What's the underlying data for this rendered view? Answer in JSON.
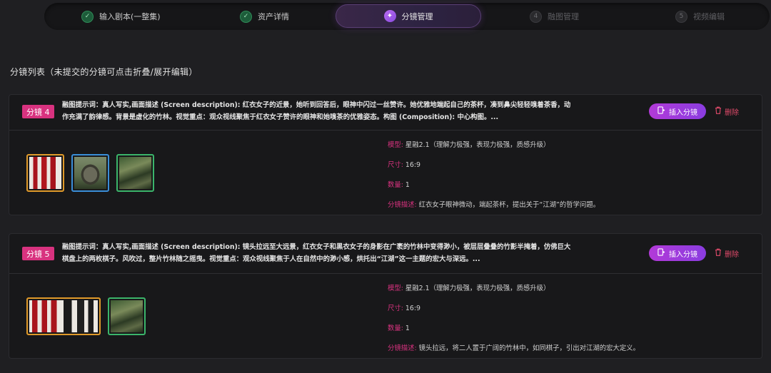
{
  "steps": [
    {
      "num": "✓",
      "label": "输入剧本(一整集)",
      "state": "done"
    },
    {
      "num": "✓",
      "label": "资产详情",
      "state": "done"
    },
    {
      "num": "✦",
      "label": "分镜管理",
      "state": "active"
    },
    {
      "num": "4",
      "label": "融图管理",
      "state": "todo"
    },
    {
      "num": "5",
      "label": "视频编辑",
      "state": "todo"
    }
  ],
  "section_title": "分镜列表（未提交的分镜可点击折叠/展开编辑）",
  "shots": [
    {
      "tag": "分镜 4",
      "prompt": "融图提示词：真人写实,画面描述 (Screen description): 红衣女子的近景，她听到回答后，眼神中闪过一丝赞许。她优雅地端起自己的茶杯，凑到鼻尖轻轻嗅着茶香，动作充满了韵律感。背景是虚化的竹林。视觉重点：观众视线聚焦于红衣女子赞许的眼神和她嗅茶的优雅姿态。构图 (Composition): 中心构图。...",
      "insert_label": "插入分镜",
      "delete_label": "删除",
      "model_key": "模型:",
      "model_val": "星融2.1（理解力极强，表现力极强，质感升级）",
      "size_key": "尺寸:",
      "size_val": "16:9",
      "count_key": "数量:",
      "count_val": "1",
      "desc_key": "分镜描述:",
      "desc_val": "红衣女子眼神微动，端起茶杯，提出关于“江湖”的哲学问题。"
    },
    {
      "tag": "分镜 5",
      "prompt": "融图提示词：真人写实,画面描述 (Screen description): 镜头拉远至大远景，红衣女子和黑衣女子的身影在广袤的竹林中变得渺小，被层层叠叠的竹影半掩着，仿佛巨大棋盘上的两枚棋子。风吹过，整片竹林随之摇曳。视觉重点：观众视线聚焦于人在自然中的渺小感，烘托出“江湖”这一主题的宏大与深远。...",
      "insert_label": "插入分镜",
      "delete_label": "删除",
      "model_key": "模型:",
      "model_val": "星融2.1（理解力极强，表现力极强，质感升级）",
      "size_key": "尺寸:",
      "size_val": "16:9",
      "count_key": "数量:",
      "count_val": "1",
      "desc_key": "分镜描述:",
      "desc_val": "镜头拉远，将二人置于广阔的竹林中，如同棋子，引出对江湖的宏大定义。"
    }
  ],
  "icons": {
    "check": "check-icon",
    "active": "sparkle-icon",
    "insert": "insert-shot-icon",
    "delete": "trash-icon"
  },
  "colors": {
    "accent_pink": "#d8327f",
    "accent_purple": "#9a3ce0",
    "done_green": "#2f8c58",
    "background": "#1f1f22"
  }
}
